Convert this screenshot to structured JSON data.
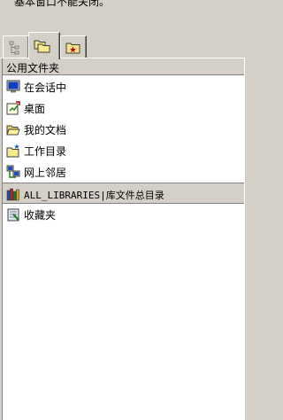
{
  "top_text": "基本窗口不能关闭。",
  "tabs": [
    {
      "icon": "tree-structure-icon",
      "active": false
    },
    {
      "icon": "folders-icon",
      "active": true
    },
    {
      "icon": "star-folder-icon",
      "active": false
    }
  ],
  "panel": {
    "title": "公用文件夹",
    "items": [
      {
        "label": "在会话中",
        "icon": "monitor-icon"
      },
      {
        "label": "桌面",
        "icon": "desktop-icon"
      },
      {
        "label": "我的文档",
        "icon": "open-folder-icon"
      },
      {
        "label": "工作目录",
        "icon": "work-folder-icon"
      },
      {
        "label": "网上邻居",
        "icon": "network-icon"
      },
      {
        "label": "ALL_LIBRARIES|库文件总目录",
        "icon": "library-icon",
        "selected": true
      },
      {
        "label": "收藏夹",
        "icon": "favorites-icon"
      }
    ]
  },
  "colors": {
    "window_bg": "#d4d0c8",
    "panel_bg": "#ffffff",
    "selected_bg": "#d4d0c8"
  }
}
